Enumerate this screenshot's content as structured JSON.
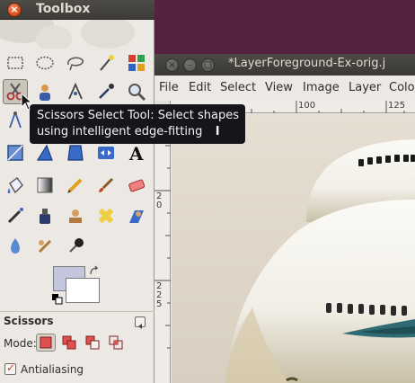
{
  "toolbox": {
    "title": "Toolbox",
    "tools": [
      {
        "name": "rect-select-icon"
      },
      {
        "name": "ellipse-select-icon"
      },
      {
        "name": "free-select-icon"
      },
      {
        "name": "fuzzy-select-icon"
      },
      {
        "name": "select-by-color-icon"
      },
      {
        "name": "scissors-select-icon"
      },
      {
        "name": "foreground-select-icon"
      },
      {
        "name": "paths-icon"
      },
      {
        "name": "color-picker-icon"
      },
      {
        "name": "zoom-icon"
      },
      {
        "name": "measure-icon"
      },
      {
        "name": "move-icon"
      },
      {
        "name": "align-icon"
      },
      {
        "name": "crop-icon"
      },
      {
        "name": "rotate-icon"
      },
      {
        "name": "scale-icon"
      },
      {
        "name": "shear-icon"
      },
      {
        "name": "perspective-icon"
      },
      {
        "name": "flip-icon"
      },
      {
        "name": "text-icon"
      },
      {
        "name": "bucket-fill-icon"
      },
      {
        "name": "blend-icon"
      },
      {
        "name": "pencil-icon"
      },
      {
        "name": "paintbrush-icon"
      },
      {
        "name": "eraser-icon"
      },
      {
        "name": "airbrush-icon"
      },
      {
        "name": "ink-icon"
      },
      {
        "name": "clone-icon"
      },
      {
        "name": "heal-icon"
      },
      {
        "name": "perspective-clone-icon"
      },
      {
        "name": "blur-icon"
      },
      {
        "name": "smudge-icon"
      },
      {
        "name": "dodge-burn-icon"
      }
    ],
    "colors": {
      "foreground": "#c3c6dd",
      "background": "#ffffff"
    },
    "options": {
      "title": "Scissors",
      "mode_label": "Mode:",
      "antialiasing_label": "Antialiasing",
      "antialiasing_checked": true
    }
  },
  "tooltip": {
    "line1": "Scissors Select Tool: Select shapes",
    "line2": "using intelligent edge-fitting",
    "shortcut": "I"
  },
  "image_window": {
    "title": "*LayerForeground-Ex-orig.j",
    "menu": [
      "File",
      "Edit",
      "Select",
      "View",
      "Image",
      "Layer",
      "Colo"
    ],
    "ruler_h": [
      "100",
      "125"
    ],
    "ruler_v": [
      "2\n0",
      "2\n2\n5"
    ]
  },
  "colors": {
    "accent": "#e0501d",
    "dark": "#3c3b37",
    "tooltip_bg": "#16161a"
  }
}
